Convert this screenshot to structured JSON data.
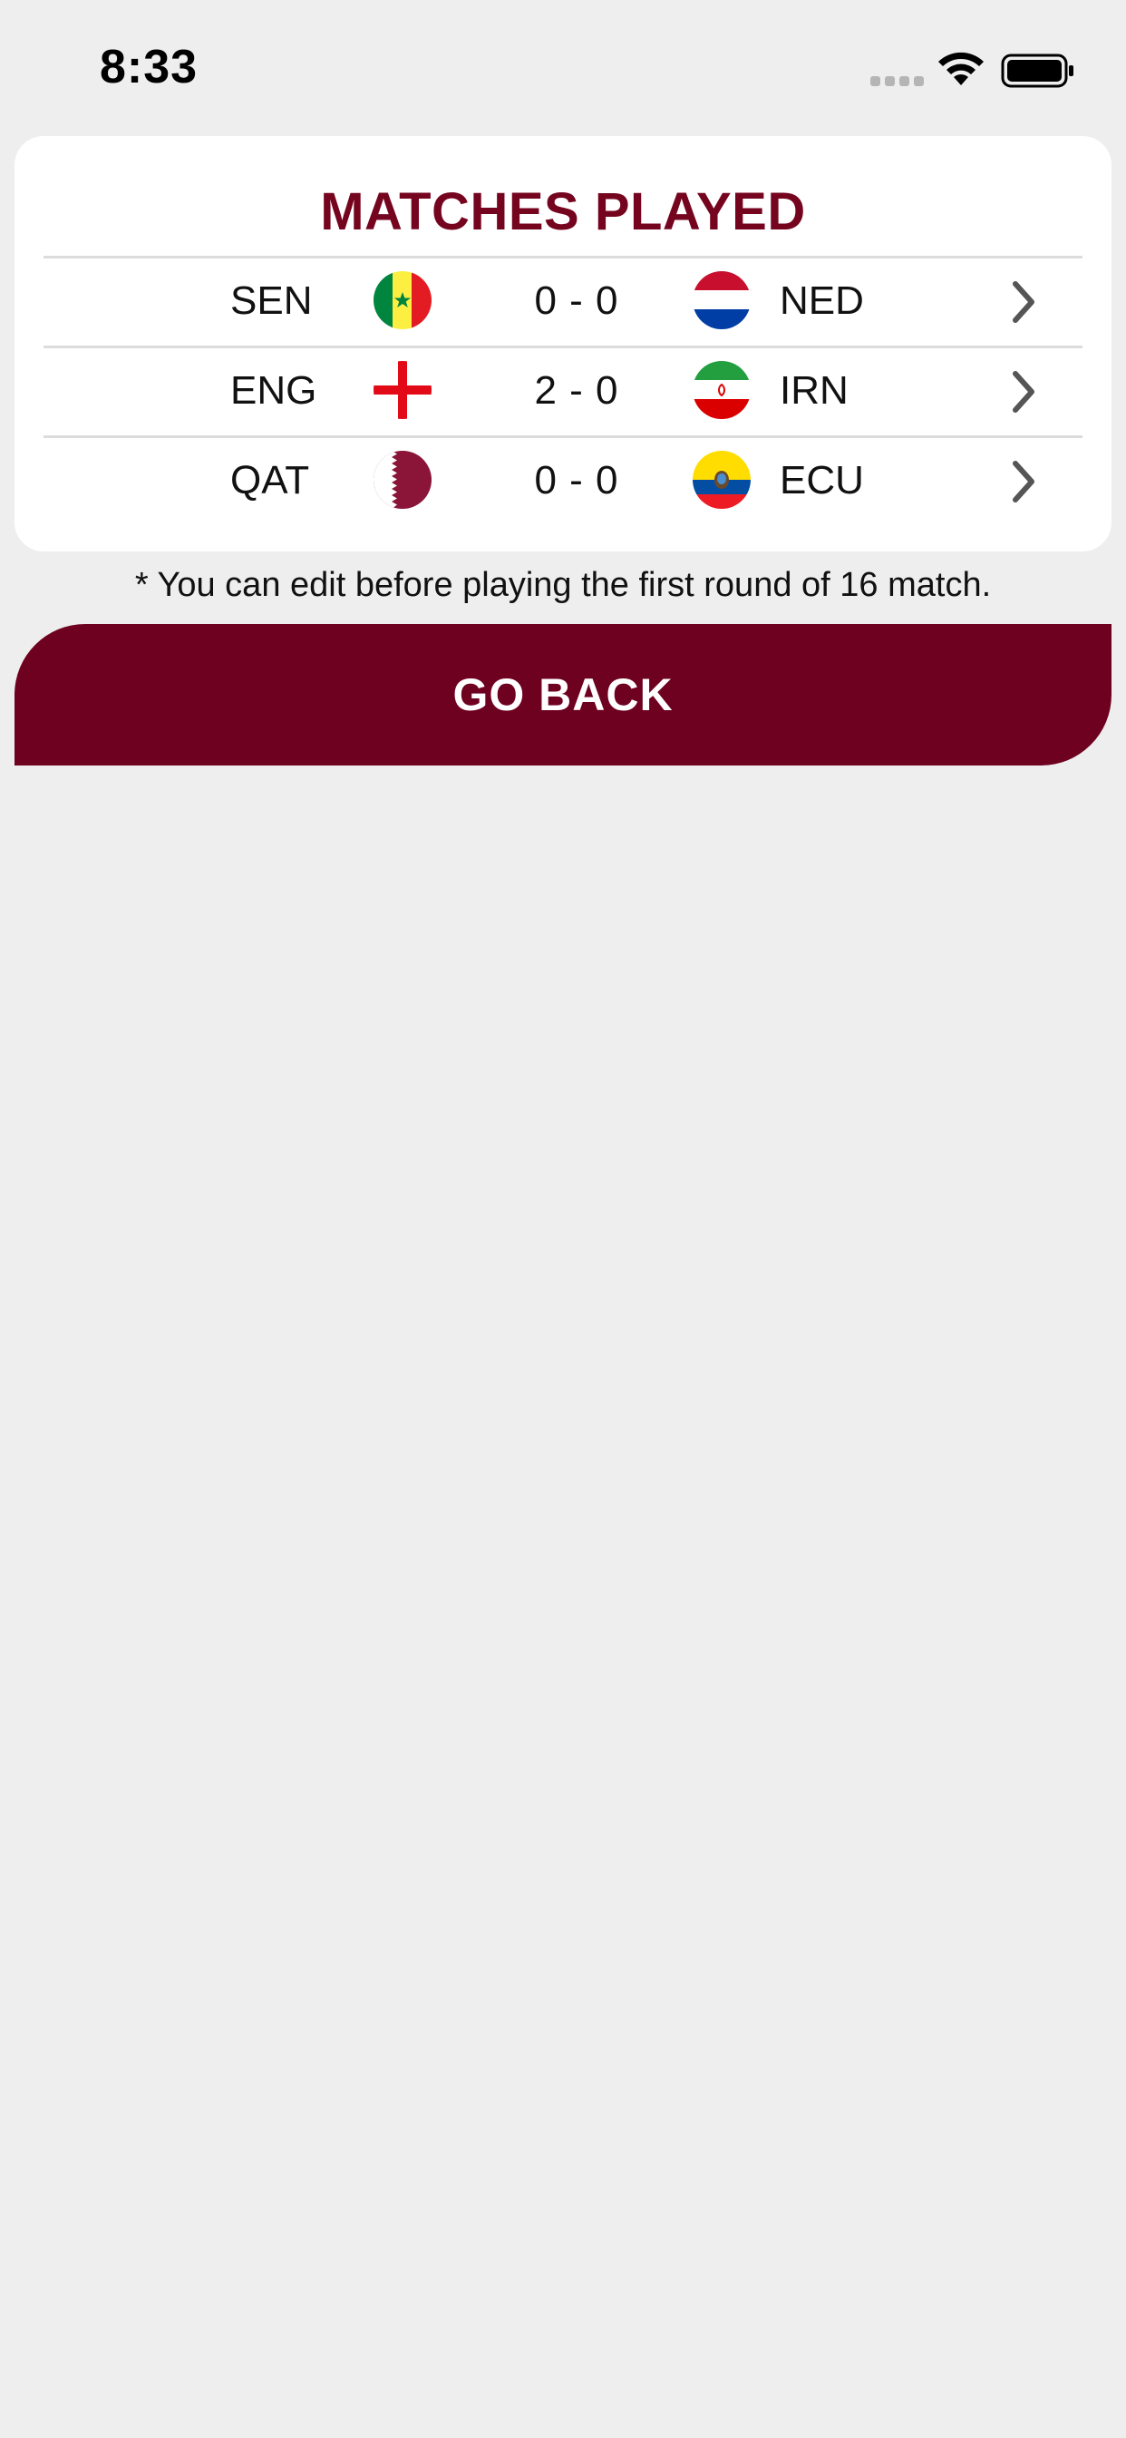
{
  "status_bar": {
    "time": "8:33"
  },
  "card": {
    "title": "MATCHES PLAYED",
    "matches": [
      {
        "home": "SEN",
        "home_flag": "senegal-flag-icon",
        "score": "0 - 0",
        "away": "NED",
        "away_flag": "netherlands-flag-icon"
      },
      {
        "home": "ENG",
        "home_flag": "england-flag-icon",
        "score": "2 - 0",
        "away": "IRN",
        "away_flag": "iran-flag-icon"
      },
      {
        "home": "QAT",
        "home_flag": "qatar-flag-icon",
        "score": "0 - 0",
        "away": "ECU",
        "away_flag": "ecuador-flag-icon"
      }
    ]
  },
  "note": "* You can edit before playing the first round of 16 match.",
  "actions": {
    "go_back_label": "GO BACK"
  },
  "colors": {
    "brand": "#75051f",
    "button": "#6e0020",
    "background": "#eeeeee"
  }
}
